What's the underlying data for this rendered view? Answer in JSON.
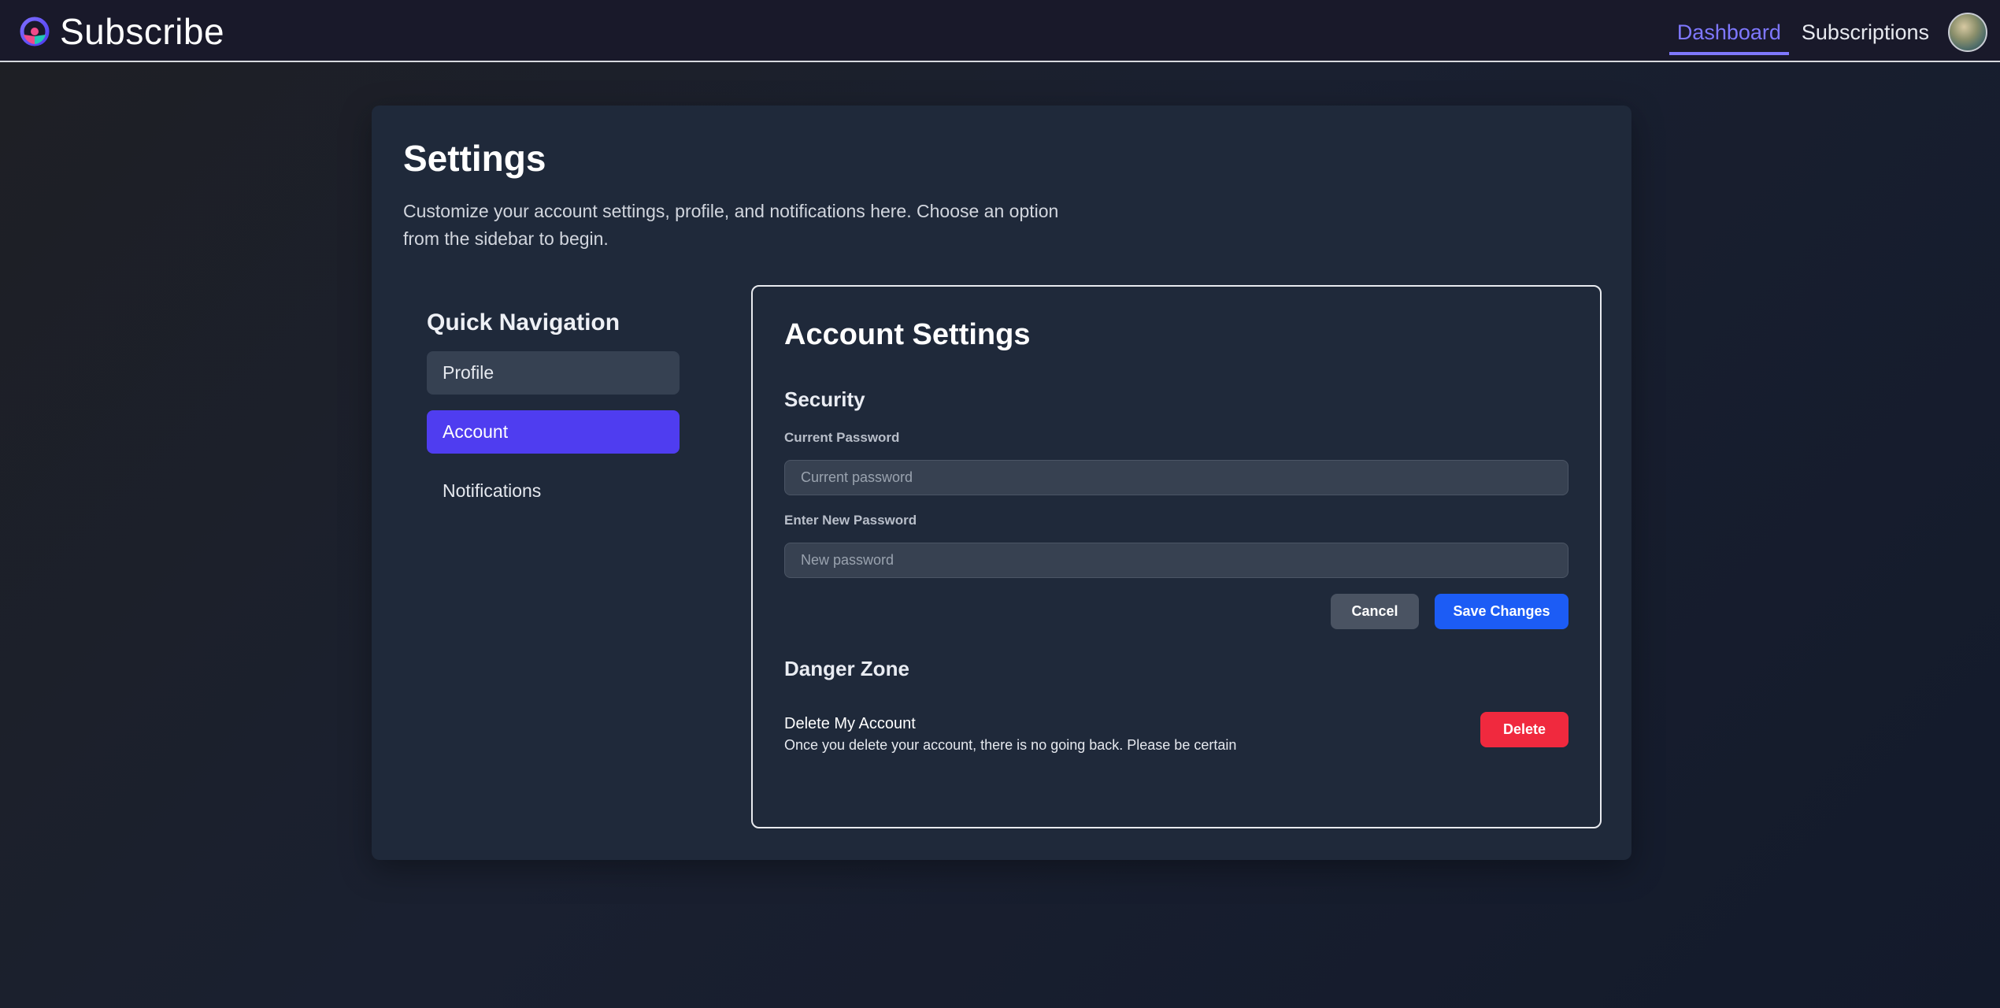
{
  "app": {
    "brand_name": "Subscribe"
  },
  "nav": {
    "items": [
      {
        "label": "Dashboard",
        "active": true
      },
      {
        "label": "Subscriptions",
        "active": false
      }
    ],
    "avatar_icon": "user-avatar-icon"
  },
  "page": {
    "title": "Settings",
    "description": "Customize your account settings, profile, and notifications here. Choose an option from the sidebar to begin."
  },
  "sidebar": {
    "title": "Quick Navigation",
    "items": [
      {
        "label": "Profile",
        "active": false
      },
      {
        "label": "Account",
        "active": true
      },
      {
        "label": "Notifications",
        "active": false
      }
    ]
  },
  "account": {
    "title": "Account Settings",
    "security": {
      "title": "Security",
      "current_password_label": "Current Password",
      "current_password_placeholder": "Current password",
      "new_password_label": "Enter New Password",
      "new_password_placeholder": "New password",
      "cancel_label": "Cancel",
      "save_label": "Save Changes"
    },
    "danger": {
      "title": "Danger Zone",
      "item_title": "Delete My Account",
      "item_desc": "Once you delete your account, there is no going back. Please be certain",
      "delete_label": "Delete"
    }
  },
  "colors": {
    "accent": "#7f78ff",
    "active_nav_item": "#4f3df0",
    "save_button": "#1c5cf5",
    "delete_button": "#f0293e",
    "cancel_button": "#4a5362"
  }
}
